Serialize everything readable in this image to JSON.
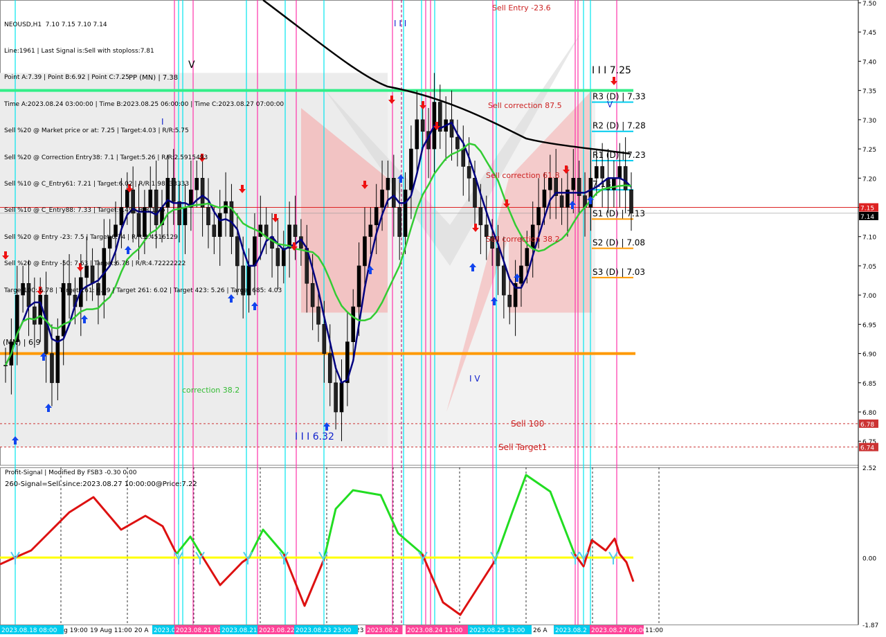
{
  "symbol_line": "NEOUSD,H1  7.10 7.15 7.10 7.14",
  "info_lines": [
    "Line:1961 | Last Signal is:Sell with stoploss:7.81",
    "Point A:7.39 | Point B:6.92 | Point C:7.25",
    "Time A:2023.08.24 03:00:00 | Time B:2023.08.25 06:00:00 | Time C:2023.08.27 07:00:00",
    "Sell %20 @ Market price or at: 7.25 | Target:4.03 | R/R:5.75",
    "Sell %20 @ Correction Entry38: 7.1 | Target:5.26 | R/R:2.5915493",
    "Sell %10 @ C_Entry61: 7.21 | Target:6.02 | R/R:1.98333333",
    "Sell %10 @ C_Entry88: 7.33 | Target:6.49 | R/R:1.75",
    "Sell %20 @ Entry -23: 7.5 | Target:6.74 | R/R:2.4516129",
    "Sell %20 @ Entry -50: 7.63 | Target:6.78 | R/R:4.72222222",
    "Target100: 6.78 | Target 161: 6.49 | Target 261: 6.02 | Target 423: 5.26 | Target 685: 4.03"
  ],
  "indicator": {
    "title": "Profit-Signal | Modified By FSB3 -0.30 0.00",
    "signal": "260-Signal=Sell since:2023.08.27 10:00:00@Price:7.22",
    "axis_labels": [
      "2.52",
      "0.00",
      "-1.87"
    ]
  },
  "colors": {
    "bull_line": "#22dd22",
    "bear_line": "#dd1111",
    "zero_line": "#ffff00",
    "orange": "#ff9900",
    "navy": "#000080",
    "ma_green": "#33cc33",
    "ma_black": "#000000",
    "pivot_cyan": "#00ccee",
    "magenta_v": "#ff33aa",
    "cyan_v": "#00e5ee"
  },
  "chart_data": {
    "type": "candlestick",
    "symbol": "NEOUSD",
    "timeframe": "H1",
    "ylim": [
      6.71,
      7.5
    ],
    "y_ticks": [
      "7.50",
      "7.45",
      "7.40",
      "7.35",
      "7.30",
      "7.25",
      "7.20",
      "7.15",
      "7.10",
      "7.05",
      "7.00",
      "6.95",
      "6.90",
      "6.85",
      "6.80",
      "6.75"
    ],
    "current_price_labels": [
      "7.15",
      "7.14"
    ],
    "x_tick_labels": [
      "18 Aug 19:00",
      "19 Aug 11:00",
      "20 A",
      "23",
      "26 A"
    ],
    "x_highlight_labels": [
      "2023.08.18 08:00",
      "2023.08.20",
      "2023.08.21 03:00",
      "2023.08.21",
      "2023.08.22",
      "2023.08.23 23:00",
      "2023.08.2",
      "2023.08.24 11:00",
      "2023.08.25 13:00",
      "2023.08.2",
      "2023.08.27 09:00",
      "11:00"
    ],
    "levels": [
      {
        "label": "R3 (D) | 7.33",
        "price": 7.33
      },
      {
        "label": "R2 (D) | 7.28",
        "price": 7.28
      },
      {
        "label": "R1 (D) | 7.23",
        "price": 7.23
      },
      {
        "label": "7.18",
        "price": 7.18
      },
      {
        "label": "S1 (D) | 7.13",
        "price": 7.13
      },
      {
        "label": "S2 (D) | 7.08",
        "price": 7.08
      },
      {
        "label": "S3 (D) | 7.03",
        "price": 7.03
      }
    ],
    "lines": [
      {
        "label": "Sell 100",
        "price": 6.78,
        "tag": "6.78"
      },
      {
        "label": "Sell Target1",
        "price": 6.74,
        "tag": "6.74"
      },
      {
        "label": "MN",
        "price": 6.9,
        "text": "| 6.9"
      }
    ],
    "annotations": [
      "Sell Entry -23.6",
      "Sell correction 87.5",
      "Sell correction 61.8",
      "Sell correction 38.2",
      "correction 38.2",
      "I I I 7.25",
      "I I I 6.32",
      "I V",
      "I I I",
      "V",
      "I",
      "V",
      "PP (MN) | 7.38"
    ],
    "closes": [
      6.88,
      6.92,
      7.0,
      7.02,
      6.98,
      6.95,
      7.0,
      6.9,
      6.85,
      6.93,
      7.02,
      7.0,
      6.98,
      7.03,
      7.05,
      7.02,
      7.0,
      7.08,
      7.1,
      7.12,
      7.15,
      7.18,
      7.14,
      7.1,
      7.15,
      7.18,
      7.12,
      7.15,
      7.2,
      7.16,
      7.12,
      7.15,
      7.18,
      7.2,
      7.15,
      7.12,
      7.1,
      7.14,
      7.16,
      7.1,
      7.05,
      7.0,
      7.05,
      7.1,
      7.12,
      7.1,
      7.08,
      7.05,
      7.08,
      7.12,
      7.1,
      7.08,
      7.02,
      6.98,
      6.95,
      6.9,
      6.85,
      6.8,
      6.85,
      6.92,
      6.98,
      7.05,
      7.1,
      7.12,
      7.15,
      7.18,
      7.2,
      7.15,
      7.1,
      7.18,
      7.25,
      7.3,
      7.28,
      7.25,
      7.33,
      7.28,
      7.3,
      7.27,
      7.25,
      7.22,
      7.2,
      7.15,
      7.12,
      7.1,
      7.08,
      7.05,
      7.0,
      6.98,
      7.02,
      7.05,
      7.08,
      7.12,
      7.15,
      7.18,
      7.2,
      7.17,
      7.15,
      7.18,
      7.2,
      7.17,
      7.15,
      7.2,
      7.22,
      7.2,
      7.18,
      7.2,
      7.22,
      7.18,
      7.14
    ]
  }
}
